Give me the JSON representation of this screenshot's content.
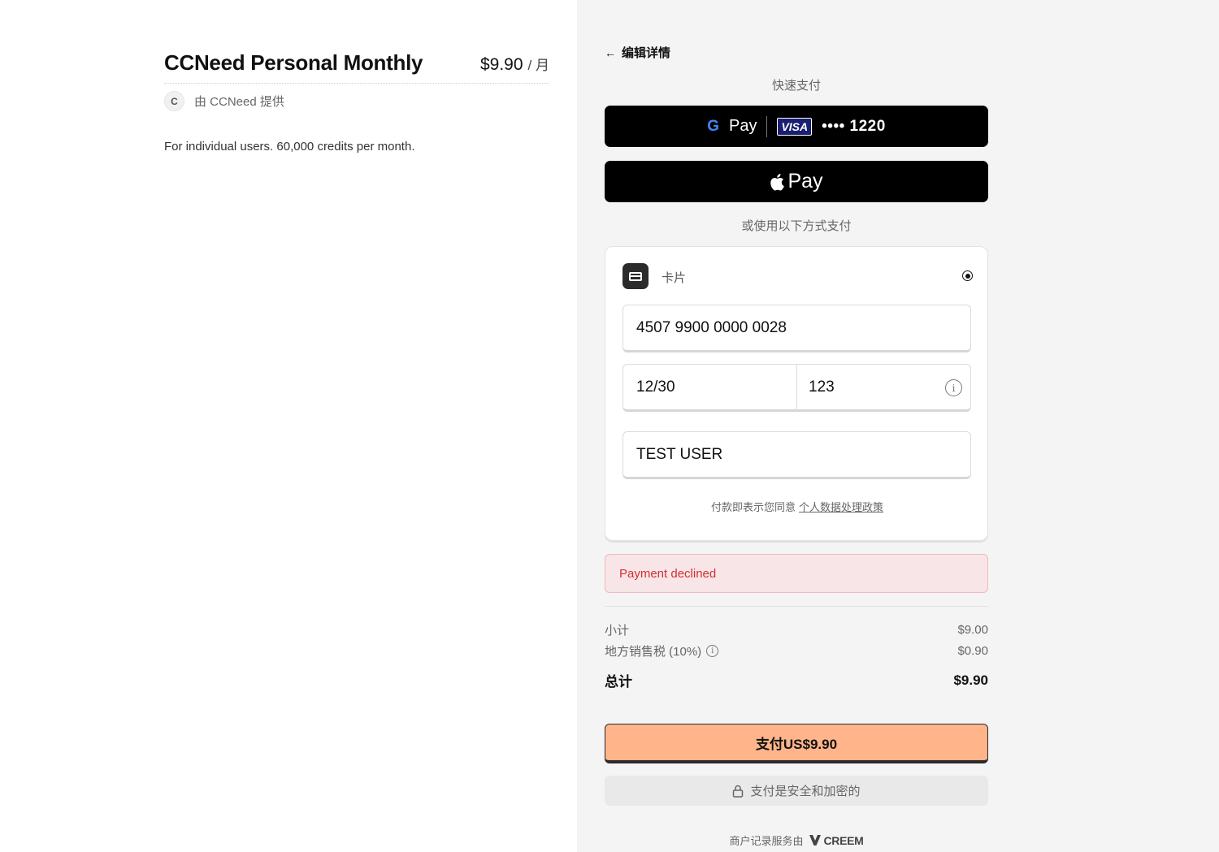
{
  "product": {
    "title": "CCNeed Personal Monthly",
    "price": "$9.90",
    "period": "/ 月",
    "seller_initial": "C",
    "seller_text": "由 CCNeed 提供",
    "description": "For individual users. 60,000 credits per month."
  },
  "checkout": {
    "back_label": "编辑详情",
    "quick_pay_label": "快速支付",
    "gpay": {
      "g_letter": "G",
      "pay_word": "Pay",
      "card_brand": "VISA",
      "card_last4": "•••• 1220"
    },
    "apay": {
      "pay_word": "Pay"
    },
    "or_label": "或使用以下方式支付",
    "card": {
      "method_label": "卡片",
      "number": "4507 9900 0000 0028",
      "expiry": "12/30",
      "cvc": "123",
      "info_glyph": "i",
      "name": "TEST USER",
      "consent_text": "付款即表示您同意",
      "policy_link": "个人数据处理政策"
    },
    "error": "Payment declined",
    "summary": {
      "subtotal_label": "小计",
      "subtotal_value": "$9.00",
      "tax_label": "地方销售税 (10%)",
      "tax_info_glyph": "i",
      "tax_value": "$0.90",
      "total_label": "总计",
      "total_value": "$9.90"
    },
    "pay_button": "支付US$9.90",
    "secure_text": "支付是安全和加密的",
    "footer_text": "商户记录服务由",
    "footer_brand": "CREEM"
  },
  "colors": {
    "accent_button": "#ffb48a",
    "error_bg": "#f8e5e7",
    "error_text": "#d32f2f",
    "right_panel_bg": "#f4f4f4"
  },
  "icons": [
    "back-arrow-icon",
    "google-g-icon",
    "visa-icon",
    "apple-icon",
    "card-icon",
    "info-icon",
    "lock-icon",
    "creem-logo-icon"
  ]
}
